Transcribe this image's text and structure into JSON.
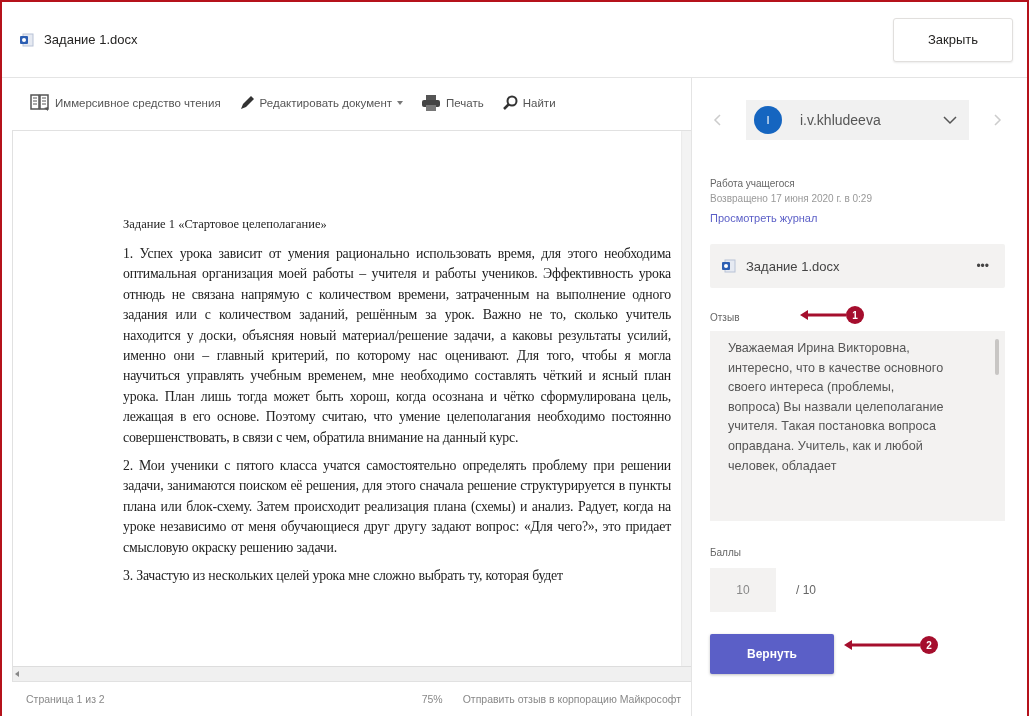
{
  "header": {
    "file_name": "Задание 1.docx",
    "close_button": "Закрыть"
  },
  "toolbar": [
    "Иммерсивное средство чтения",
    "Редактировать документ",
    "Печать",
    "Найти"
  ],
  "document": {
    "heading": "Задание 1 «Стартовое целеполагание»",
    "paragraphs": [
      "1. Успех урока зависит от умения рационально использовать время, для этого необходима оптимальная организация моей работы – учителя и работы учеников. Эффективность урока отнюдь не связана напрямую с количеством времени, затраченным на выполнение одного задания или с количеством заданий, решённым за урок. Важно не то, сколько учитель находится у доски, объясняя новый материал/решение задачи, а каковы результаты усилий, именно они – главный критерий, по которому нас оценивают. Для того, чтобы я могла научиться управлять учебным временем, мне необходимо составлять чёткий и ясный план урока. План лишь тогда может быть хорош, когда осознана и чётко сформулирована цель, лежащая в его основе. Поэтому считаю, что умение целеполагания необходимо постоянно совершенствовать, в связи с чем, обратила внимание на данный курс.",
      "2. Мои ученики с пятого класса учатся самостоятельно определять проблему при решении задачи, занимаются поиском её решения, для этого сначала решение структурируется в пункты плана или блок-схему. Затем происходит реализация плана (схемы) и анализ. Радует, когда на уроке независимо от меня обучающиеся друг другу задают вопрос: «Для чего?», это придает смысловую окраску решению задачи.",
      "3. Зачастую из нескольких целей урока мне сложно выбрать ту, которая будет"
    ]
  },
  "status_bar": {
    "page": "Страница 1 из 2",
    "zoom": "75%",
    "feedback_link": "Отправить отзыв в корпорацию Майкрософт"
  },
  "panel": {
    "student": {
      "avatar": "I",
      "name": "i.v.khludeeva"
    },
    "work_title": "Работа учащегося",
    "returned": "Возвращено 17 июня 2020 г. в 0:29",
    "history_link": "Просмотреть журнал",
    "file": {
      "name": "Задание 1.docx",
      "more": "•••"
    },
    "feedback_label": "Отзыв",
    "feedback": "Уважаемая Ирина Викторовна, интересно, что в качестве основного своего интереса (проблемы, вопроса) Вы назвали целеполагание учителя. Такая постановка вопроса оправдана.  Учитель, как и любой человек, обладает",
    "points_label": "Баллы",
    "points": "10",
    "points_max": "/ 10",
    "return_button": "Вернуть"
  },
  "annotations": [
    {
      "label": "1"
    },
    {
      "label": "2"
    }
  ]
}
